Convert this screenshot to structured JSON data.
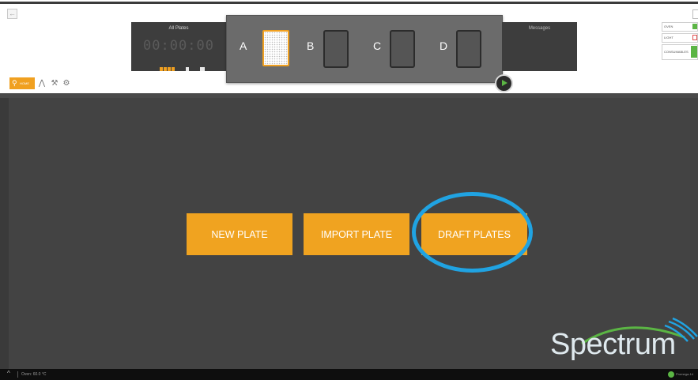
{
  "header": {
    "timer": {
      "title": "All Plates",
      "time": "00:00:00"
    },
    "plates": [
      {
        "letter": "A",
        "loaded": true
      },
      {
        "letter": "B",
        "loaded": false
      },
      {
        "letter": "C",
        "loaded": false
      },
      {
        "letter": "D",
        "loaded": false
      }
    ],
    "messages_title": "Messages",
    "status": {
      "oven": "OVEN",
      "light": "LIGHT",
      "consumables": "CONSUMABLES"
    },
    "home_label": "HOME"
  },
  "main": {
    "buttons": [
      "NEW PLATE",
      "IMPORT PLATE",
      "DRAFT PLATES"
    ],
    "highlighted_button": "DRAFT PLATES"
  },
  "brand": {
    "logo_text": "Spectrum"
  },
  "footer": {
    "oven_status": "Oven: 60.0 °C",
    "connection": "Promega-14"
  },
  "colors": {
    "accent": "#f0a320",
    "highlight_ring": "#20a3e2",
    "status_ok": "#5bb544",
    "status_alert": "#e05050"
  }
}
